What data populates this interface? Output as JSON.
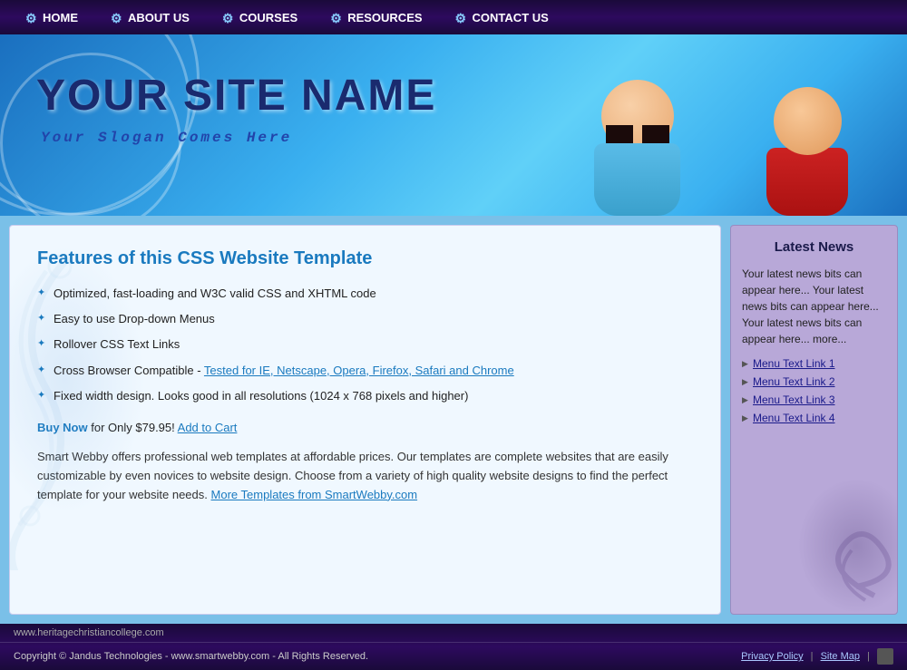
{
  "nav": {
    "items": [
      {
        "id": "home",
        "label": "HOME",
        "icon": "⚙"
      },
      {
        "id": "about",
        "label": "ABOUT US",
        "icon": "⚙"
      },
      {
        "id": "courses",
        "label": "COURSES",
        "icon": "⚙"
      },
      {
        "id": "resources",
        "label": "RESOURCES",
        "icon": "⚙"
      },
      {
        "id": "contact",
        "label": "CONTACT US",
        "icon": "⚙"
      }
    ]
  },
  "header": {
    "site_name": "YOUR SITE NAME",
    "slogan": "Your Slogan Comes Here"
  },
  "content": {
    "features_title": "Features of this CSS Website Template",
    "features": [
      "Optimized, fast-loading and W3C valid CSS and XHTML code",
      "Easy to use Drop-down Menus",
      "Rollover CSS Text Links",
      "Cross Browser Compatible - ",
      "Fixed width design. Looks good in all resolutions (1024 x 768 pixels and higher)"
    ],
    "cross_browser_link": "Tested for IE, Netscape, Opera, Firefox, Safari and Chrome",
    "buy_now_label": "Buy Now",
    "buy_price": "for Only $79.95!",
    "add_to_cart": "Add to Cart",
    "description": "Smart Webby offers professional web templates at affordable prices. Our templates are complete websites that are easily customizable by even novices to website design. Choose from a variety of high quality website designs to find the perfect template for your website needs.",
    "more_templates_link": "More Templates from SmartWebby.com"
  },
  "sidebar": {
    "title": "Latest News",
    "news_text": "Your latest news bits can appear here... Your latest news bits can appear here... Your latest news bits can appear here... more...",
    "links": [
      "Menu Text Link 1",
      "Menu Text Link 2",
      "Menu Text Link 3",
      "Menu Text Link 4"
    ]
  },
  "footer": {
    "domain": "www.heritagechristiancollege.com",
    "copyright": "Copyright © Jandus Technologies - www.smartwebby.com - All Rights Reserved.",
    "privacy_policy": "Privacy Policy",
    "site_map": "Site Map"
  }
}
